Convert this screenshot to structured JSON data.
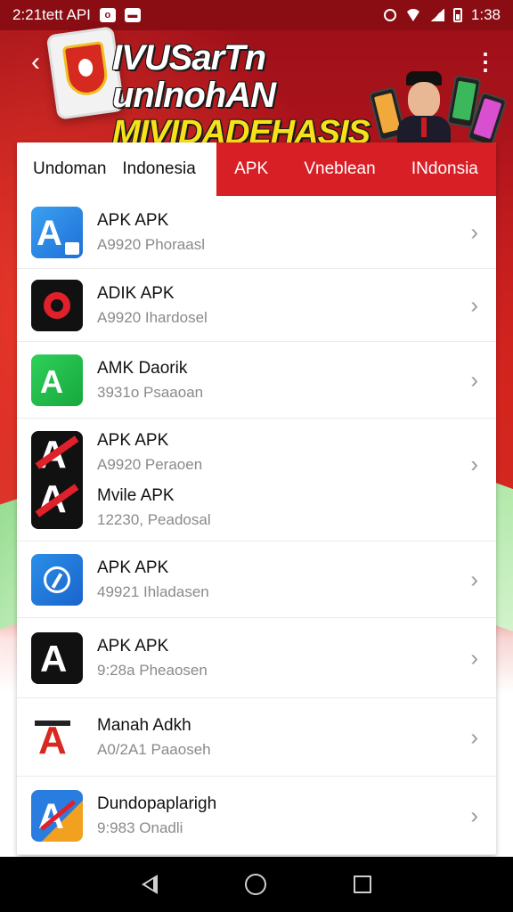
{
  "status_bar": {
    "time_left": "2:21tett API",
    "time_right": "1:38"
  },
  "header": {
    "title_line1": "IVUSarTn unlnohAN",
    "title_line2": "MIVIDADEHASIS",
    "back_icon": "arrow-left-icon",
    "menu_icon": "more-vert-icon"
  },
  "tabs": {
    "primary_left": "Undoman",
    "primary_right": "Indonesia",
    "items": [
      "APK",
      "Vneblean",
      "INdonsia"
    ]
  },
  "apps": [
    {
      "name": "APK APK",
      "sub": "A9920 Phoraasl",
      "icon": "apk-blue-icon"
    },
    {
      "name": "ADIK APK",
      "sub": "A9920 Ihardosel",
      "icon": "ring-red-icon"
    },
    {
      "name": "AMK Daorik",
      "sub": "3931o Psaaoan",
      "icon": "apk-green-icon"
    },
    {
      "name": "APK  APK",
      "sub": "A9920 Peraoen",
      "name2": "Mvile  APK",
      "sub2": "12230, Peadosal",
      "icon": "apk-black-red-icon"
    },
    {
      "name": "APK  APK",
      "sub": "49921 Ihladasen",
      "icon": "compass-blue-icon"
    },
    {
      "name": "APK  APK",
      "sub": "9:28a Pheaosen",
      "icon": "apk-black-icon"
    },
    {
      "name": "Manah Adkh",
      "sub": "A0/2A1 Paaoseh",
      "icon": "apk-white-red-icon"
    },
    {
      "name": "Dundopaplarigh",
      "sub": "9:983 Onadli",
      "icon": "apk-multicolor-icon"
    }
  ],
  "chevron": "›",
  "colors": {
    "accent_red": "#d81f26",
    "status_bar": "#8a0d14",
    "banner_yellow": "#f7e11a"
  }
}
